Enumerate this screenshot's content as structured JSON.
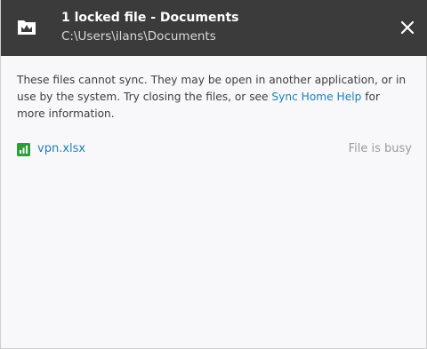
{
  "header": {
    "title": "1 locked file - Documents",
    "path": "C:\\Users\\ilans\\Documents",
    "app_icon": "folder-crown-icon",
    "close_icon": "close-icon"
  },
  "body": {
    "message_part1": "These files cannot sync. They may be open in another application, or in use by the system. Try closing the files, or see ",
    "help_link": "Sync Home Help",
    "message_part2": " for more information."
  },
  "files": [
    {
      "name": "vpn.xlsx",
      "status": "File is busy",
      "icon": "spreadsheet-icon",
      "icon_color": "#2e9e3a"
    }
  ],
  "colors": {
    "titlebar_bg": "#3b3b3b",
    "link": "#1c7fb8",
    "status_text": "#9a9a9a"
  }
}
